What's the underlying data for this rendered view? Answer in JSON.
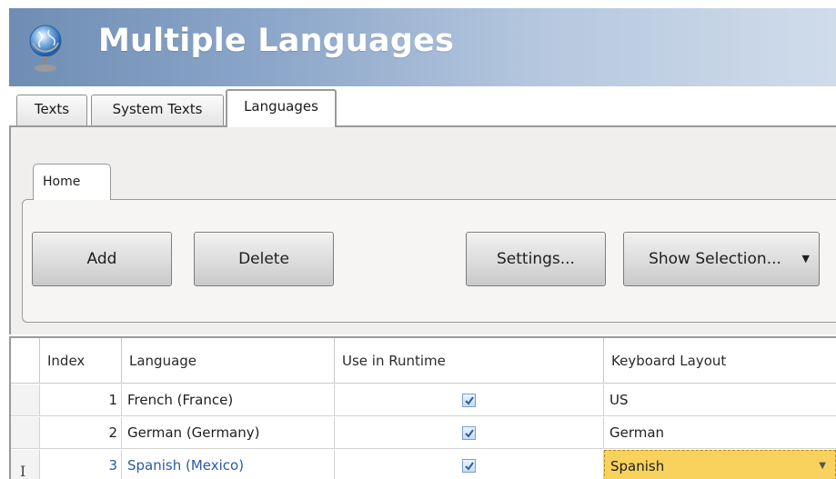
{
  "header": {
    "title": "Multiple Languages",
    "icon": "globe-icon"
  },
  "tabs": [
    {
      "label": "Texts",
      "active": false
    },
    {
      "label": "System Texts",
      "active": false
    },
    {
      "label": "Languages",
      "active": true
    }
  ],
  "ribbon": {
    "tab_label": "Home",
    "buttons": {
      "add": "Add",
      "delete": "Delete",
      "settings": "Settings...",
      "show_selection": "Show Selection..."
    }
  },
  "grid": {
    "columns": [
      "Index",
      "Language",
      "Use in Runtime",
      "Keyboard Layout"
    ],
    "rows": [
      {
        "index": "1",
        "language": "French (France)",
        "use_in_runtime": true,
        "keyboard_layout": "US"
      },
      {
        "index": "2",
        "language": "German (Germany)",
        "use_in_runtime": true,
        "keyboard_layout": "German"
      },
      {
        "index": "3",
        "language": "Spanish (Mexico)",
        "use_in_runtime": true,
        "keyboard_layout": "Spanish"
      }
    ]
  },
  "colors": {
    "header_gradient_start": "#6f8db4",
    "header_gradient_end": "#d0dcea",
    "selected_text": "#2b5aa8",
    "dropdown_highlight": "#f9d25d"
  }
}
